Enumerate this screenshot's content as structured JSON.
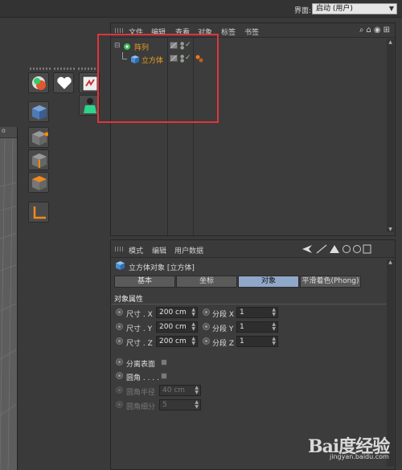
{
  "topbar": {
    "layout_label": "界面:",
    "layout_value": "启动 (用户)"
  },
  "viewport": {
    "head": "o"
  },
  "object_manager": {
    "menu": [
      "文件",
      "编辑",
      "查看",
      "对象",
      "标签",
      "书签"
    ],
    "objects": [
      {
        "name": "阵列",
        "type": "array"
      },
      {
        "name": "立方体",
        "type": "cube"
      }
    ]
  },
  "attribute_manager": {
    "menu": [
      "模式",
      "编辑",
      "用户数据"
    ],
    "title": "立方体对象 [立方体]",
    "tabs": [
      "基本",
      "坐标",
      "对象",
      "平滑着色(Phong)"
    ],
    "active_tab": "对象",
    "section": "对象属性",
    "size": [
      {
        "label": "尺寸 . X",
        "value": "200 cm"
      },
      {
        "label": "尺寸 . Y",
        "value": "200 cm"
      },
      {
        "label": "尺寸 . Z",
        "value": "200 cm"
      }
    ],
    "segments": [
      {
        "label": "分段 X",
        "value": "1"
      },
      {
        "label": "分段 Y",
        "value": "1"
      },
      {
        "label": "分段 Z",
        "value": "1"
      }
    ],
    "separate_surfaces": "分离表面",
    "fillet": "圆角 . . . .",
    "fillet_radius_label": "圆角半径",
    "fillet_radius_value": "40 cm",
    "fillet_subdiv_label": "圆角细分",
    "fillet_subdiv_value": "5"
  },
  "watermark": {
    "logo": "Bai度经验",
    "sub": "jingyan.baidu.com"
  },
  "colors": {
    "accent_tab": "#8fa7c8",
    "object_name": "#f0a020",
    "highlight": "#e0353b"
  }
}
